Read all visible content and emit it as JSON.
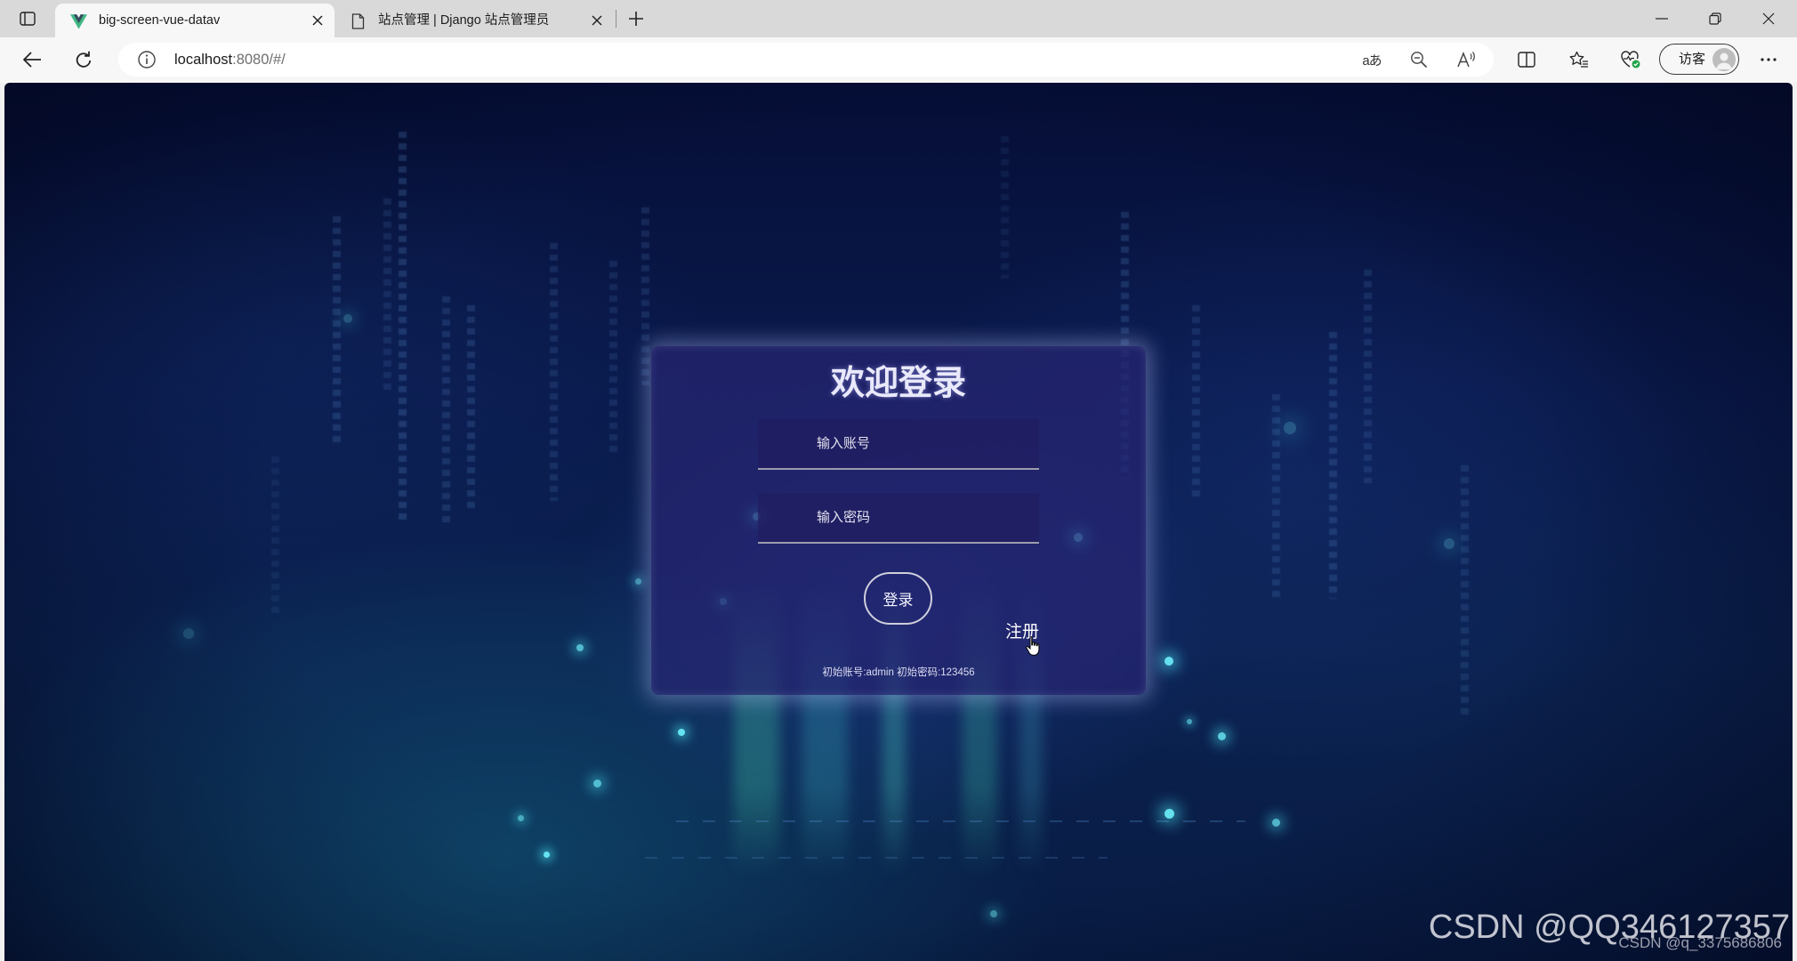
{
  "browser": {
    "tabs": [
      {
        "title": "big-screen-vue-datav",
        "icon": "vue-logo-icon",
        "active": true
      },
      {
        "title": "站点管理 | Django 站点管理员",
        "icon": "page-icon",
        "active": false
      }
    ],
    "address": {
      "host": "localhost",
      "path": ":8080/#/"
    },
    "translate_glyph": "aあ",
    "profile": {
      "label": "访客"
    }
  },
  "login": {
    "title": "欢迎登录",
    "username_placeholder": "输入账号",
    "password_placeholder": "输入密码",
    "login_button": "登录",
    "register_link": "注册",
    "hint": "初始账号:admin 初始密码:123456"
  },
  "watermark": {
    "main": "CSDN @QQ346127357",
    "sub": "CSDN @q_3375686806"
  },
  "icons": [
    "tab-actions-icon",
    "vue-logo-icon",
    "page-icon",
    "close-icon",
    "plus-icon",
    "minimize-icon",
    "restore-icon",
    "back-arrow-icon",
    "refresh-icon",
    "info-icon",
    "translate-icon",
    "zoom-out-icon",
    "read-aloud-icon",
    "split-screen-icon",
    "favorites-icon",
    "browser-essentials-icon",
    "avatar-icon",
    "more-icon",
    "cursor-hand-icon"
  ],
  "colors": {
    "tab_strip": "#d9d9d9",
    "toolbar": "#f7f7f7",
    "background_navy": "#0a1a4d",
    "card": "#26246f",
    "glow_cyan": "#6ff6ff",
    "vue_green": "#41b883",
    "vue_dark": "#35495e"
  }
}
